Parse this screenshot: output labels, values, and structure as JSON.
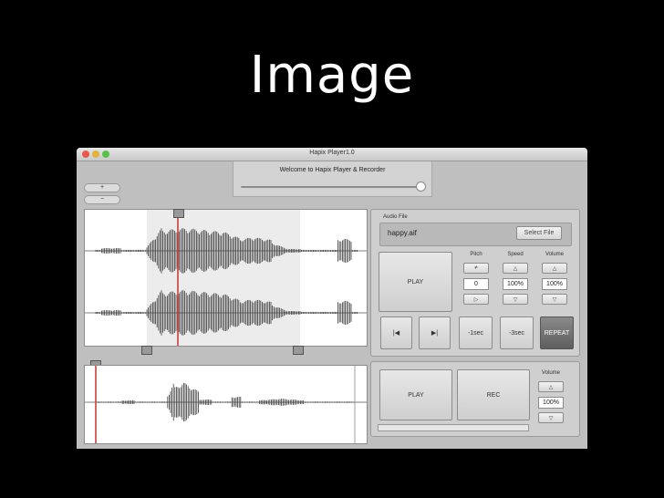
{
  "slide": {
    "title": "Image"
  },
  "window": {
    "title": "Hapix Player1.0",
    "traffic_colors": [
      "#e5594f",
      "#e0b23f",
      "#5cbf4c"
    ]
  },
  "banner": {
    "welcome": "Welcome to Hapix Player & Recorder"
  },
  "side_buttons": {
    "plus": "+",
    "minus": "−"
  },
  "player": {
    "panel_label": "Audio File",
    "file_name": "happy.aif",
    "select_file": "Select File",
    "play": "PLAY",
    "pitch": {
      "label": "Pitch",
      "reset_icon": "≠",
      "value": "0",
      "play_icon": "▷"
    },
    "speed": {
      "label": "Speed",
      "up_icon": "△",
      "value": "100%",
      "down_icon": "▽"
    },
    "volume": {
      "label": "Volume",
      "up_icon": "△",
      "value": "100%",
      "down_icon": "▽"
    },
    "skip_back_icon": "|◀",
    "skip_forward_icon": "▶|",
    "minus1": "-1sec",
    "minus3": "-3sec",
    "repeat": "REPEAT"
  },
  "recorder": {
    "play": "PLAY",
    "rec": "REC",
    "volume": {
      "label": "Volume",
      "up_icon": "△",
      "value": "100%",
      "down_icon": "▽"
    }
  },
  "colors": {
    "playhead": "#c83232",
    "waveform": "#3a3a3a"
  }
}
